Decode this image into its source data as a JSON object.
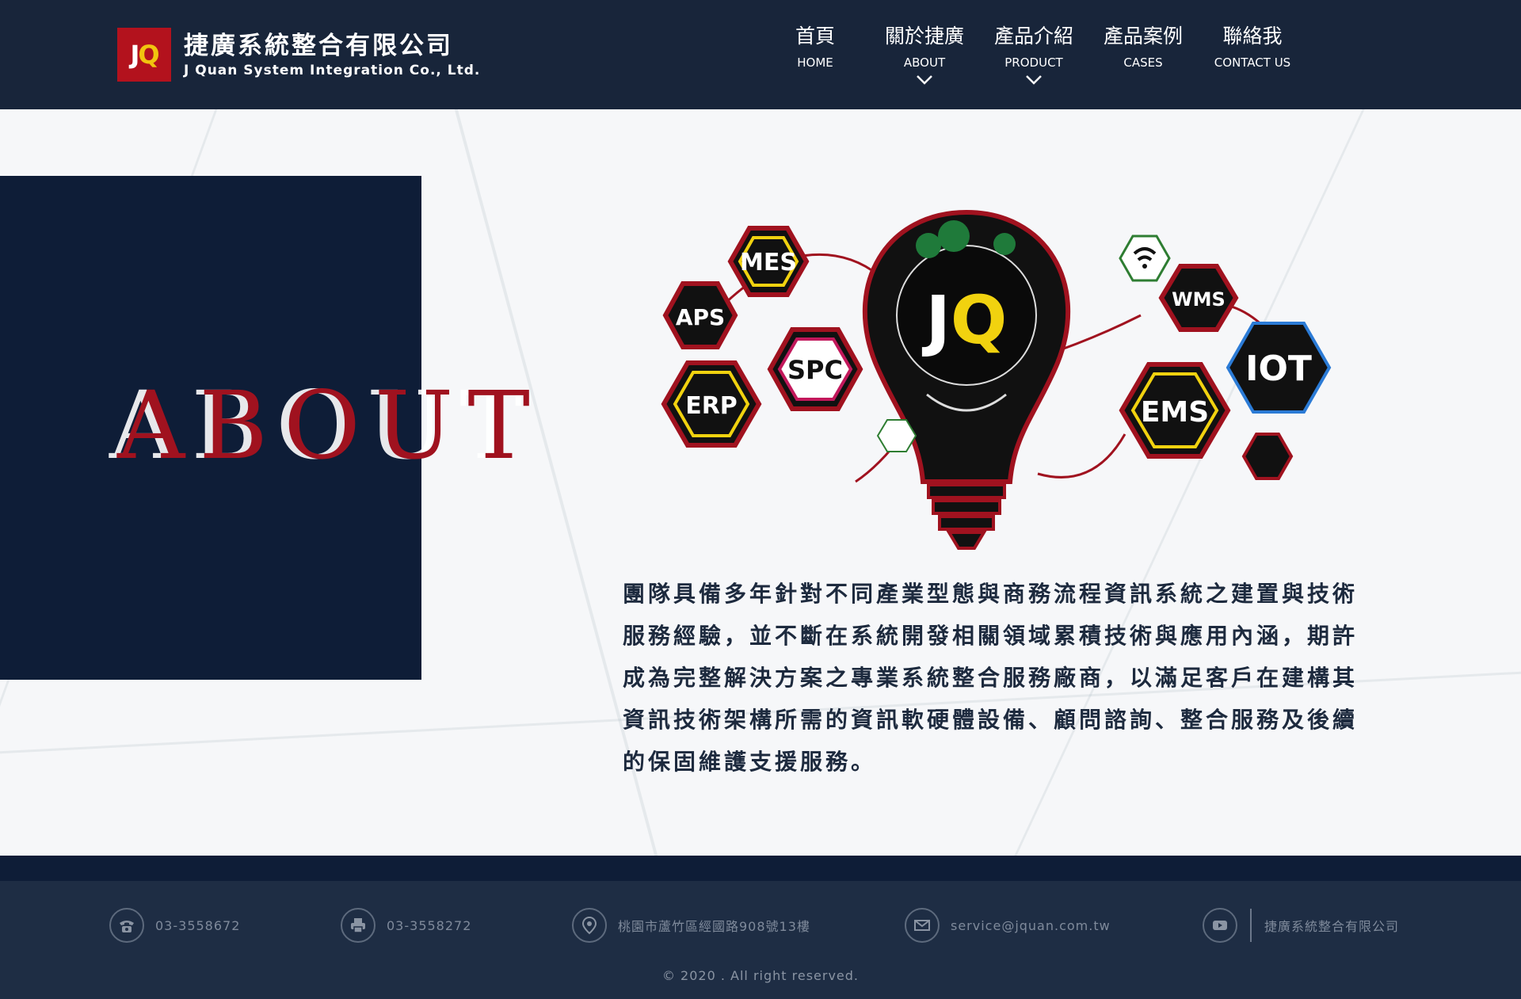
{
  "header": {
    "logo_mark_j": "J",
    "logo_mark_q": "Q",
    "company_cn": "捷廣系統整合有限公司",
    "company_en": "J Quan System Integration Co., Ltd."
  },
  "nav": [
    {
      "cn": "首頁",
      "en": "HOME",
      "dropdown": false
    },
    {
      "cn": "關於捷廣",
      "en": "ABOUT",
      "dropdown": true
    },
    {
      "cn": "產品介紹",
      "en": "PRODUCT",
      "dropdown": true
    },
    {
      "cn": "產品案例",
      "en": "CASES",
      "dropdown": false
    },
    {
      "cn": "聯絡我",
      "en": "CONTACT US",
      "dropdown": false
    }
  ],
  "hero": {
    "title": "ABOUT",
    "graphic_labels": {
      "center": "JQ",
      "mes": "MES",
      "aps": "APS",
      "spc": "SPC",
      "erp": "ERP",
      "wms": "WMS",
      "iot": "IOT",
      "ems": "EMS"
    },
    "description": "團隊具備多年針對不同產業型態與商務流程資訊系統之建置與技術服務經驗，並不斷在系統開發相關領域累積技術與應用內涵，期許成為完整解決方案之專業系統整合服務廠商，以滿足客戶在建構其資訊技術架構所需的資訊軟硬體設備、顧問諮詢、整合服務及後續的保固維護支援服務。"
  },
  "footer": {
    "phone": "03-3558672",
    "fax": "03-3558272",
    "address": "桃園市蘆竹區經國路908號13樓",
    "email": "service@jquan.com.tw",
    "youtube_label": "捷廣系統整合有限公司",
    "copyright": "© 2020 . All right reserved."
  },
  "colors": {
    "header_bg": "#18253a",
    "navy": "#0e1d37",
    "accent_red": "#a0121f",
    "footer_bg": "#1e2d44"
  }
}
